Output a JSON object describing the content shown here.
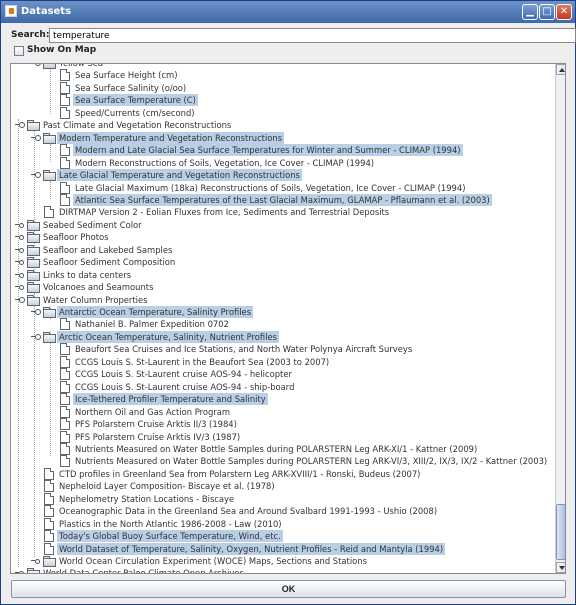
{
  "window": {
    "title": "Datasets",
    "icon": "java-app-icon",
    "controls": [
      "minimize",
      "maximize",
      "close"
    ]
  },
  "search": {
    "label": "Search:",
    "value": "temperature"
  },
  "show_on_map": {
    "label": "Show On Map",
    "checked": false
  },
  "tree": {
    "rows": [
      {
        "label": "Yellow Sea",
        "type": "folder",
        "level": 2,
        "handle": "expanded",
        "selected": false
      },
      {
        "label": "Sea Surface Height (cm)",
        "type": "file",
        "level": 3,
        "selected": false
      },
      {
        "label": "Sea Surface Salinity (o/oo)",
        "type": "file",
        "level": 3,
        "selected": false
      },
      {
        "label": "Sea Surface Temperature (C)",
        "type": "file",
        "level": 3,
        "selected": true
      },
      {
        "label": "Speed/Currents (cm/second)",
        "type": "file",
        "level": 3,
        "selected": false
      },
      {
        "label": "Past Climate and Vegetation Reconstructions",
        "type": "folder",
        "level": 1,
        "handle": "expanded",
        "selected": false
      },
      {
        "label": "Modern Temperature and Vegetation Reconstructions",
        "type": "folder",
        "level": 2,
        "handle": "expanded",
        "selected": true
      },
      {
        "label": "Modern and Late Glacial Sea Surface Temperatures for Winter and Summer - CLIMAP (1994)",
        "type": "file",
        "level": 3,
        "selected": true
      },
      {
        "label": "Modern Reconstructions of Soils, Vegetation, Ice Cover - CLIMAP (1994)",
        "type": "file",
        "level": 3,
        "selected": false
      },
      {
        "label": "Late Glacial Temperature and Vegetation Reconstructions",
        "type": "folder",
        "level": 2,
        "handle": "expanded",
        "selected": true
      },
      {
        "label": "Late Glacial Maximum (18ka) Reconstructions of Soils, Vegetation, Ice Cover - CLIMAP (1994)",
        "type": "file",
        "level": 3,
        "selected": false
      },
      {
        "label": "Atlantic Sea Surface Temperatures of the Last Glacial Maximum, GLAMAP - Pflaumann et al. (2003)",
        "type": "file",
        "level": 3,
        "selected": true
      },
      {
        "label": "DIRTMAP Version 2 - Eolian Fluxes from Ice, Sediments and Terrestrial Deposits",
        "type": "file",
        "level": 2,
        "selected": false
      },
      {
        "label": "Seabed Sediment Color",
        "type": "folder",
        "level": 1,
        "handle": "collapsed",
        "selected": false
      },
      {
        "label": "Seafloor Photos",
        "type": "folder",
        "level": 1,
        "handle": "collapsed",
        "selected": false
      },
      {
        "label": "Seafloor and Lakebed Samples",
        "type": "folder",
        "level": 1,
        "handle": "collapsed",
        "selected": false
      },
      {
        "label": "Seafloor Sediment Composition",
        "type": "folder",
        "level": 1,
        "handle": "collapsed",
        "selected": false
      },
      {
        "label": "Links to data centers",
        "type": "folder",
        "level": 1,
        "handle": "collapsed",
        "selected": false
      },
      {
        "label": "Volcanoes and Seamounts",
        "type": "folder",
        "level": 1,
        "handle": "collapsed",
        "selected": false
      },
      {
        "label": "Water Column Properties",
        "type": "folder",
        "level": 1,
        "handle": "expanded",
        "selected": false
      },
      {
        "label": "Antarctic Ocean Temperature, Salinity Profiles",
        "type": "folder",
        "level": 2,
        "handle": "expanded",
        "selected": true
      },
      {
        "label": "Nathaniel B. Palmer Expedition 0702",
        "type": "file",
        "level": 3,
        "selected": false
      },
      {
        "label": "Arctic Ocean Temperature, Salinity, Nutrient Profiles",
        "type": "folder",
        "level": 2,
        "handle": "expanded",
        "selected": true
      },
      {
        "label": "Beaufort Sea Cruises and Ice Stations, and North Water Polynya Aircraft Surveys",
        "type": "file",
        "level": 3,
        "selected": false
      },
      {
        "label": "CCGS Louis S. St-Laurent in the Beaufort Sea (2003 to 2007)",
        "type": "file",
        "level": 3,
        "selected": false
      },
      {
        "label": "CCGS Louis S. St-Laurent cruise AOS-94 - helicopter",
        "type": "file",
        "level": 3,
        "selected": false
      },
      {
        "label": "CCGS Louis S. St-Laurent cruise AOS-94 - ship-board",
        "type": "file",
        "level": 3,
        "selected": false
      },
      {
        "label": "Ice-Tethered Profiler Temperature and Salinity",
        "type": "file",
        "level": 3,
        "selected": true
      },
      {
        "label": "Northern Oil and Gas Action Program",
        "type": "file",
        "level": 3,
        "selected": false
      },
      {
        "label": "PFS Polarstern Cruise Arktis II/3 (1984)",
        "type": "file",
        "level": 3,
        "selected": false
      },
      {
        "label": "PFS Polarstern Cruise Arktis IV/3 (1987)",
        "type": "file",
        "level": 3,
        "selected": false
      },
      {
        "label": "Nutrients Measured on Water Bottle Samples during POLARSTERN Leg ARK-XI/1 - Kattner (2009)",
        "type": "file",
        "level": 3,
        "selected": false
      },
      {
        "label": "Nutrients Measured on Water Bottle Samples during POLARSTERN Leg ARK-VI/3, XIII/2, IX/3, IX/2 - Kattner (2003)",
        "type": "file",
        "level": 3,
        "selected": false
      },
      {
        "label": "CTD profiles in Greenland Sea from Polarstern Leg ARK-XVIII/1 - Ronski, Budeus  (2007)",
        "type": "file",
        "level": 2,
        "selected": false
      },
      {
        "label": "Nepheloid Layer Composition- Biscaye et al. (1978)",
        "type": "file",
        "level": 2,
        "selected": false
      },
      {
        "label": "Nephelometry Station Locations - Biscaye",
        "type": "file",
        "level": 2,
        "selected": false
      },
      {
        "label": "Oceanographic Data in the Greenland Sea and Around Svalbard 1991-1993 - Ushio (2008)",
        "type": "file",
        "level": 2,
        "selected": false
      },
      {
        "label": "Plastics in the North Atlantic 1986-2008 - Law (2010)",
        "type": "file",
        "level": 2,
        "selected": false
      },
      {
        "label": "Today's Global Buoy Surface Temperature, Wind, etc.",
        "type": "file",
        "level": 2,
        "selected": true
      },
      {
        "label": "World Dataset of Temperature, Salinity, Oxygen, Nutrient Profiles - Reid and Mantyla (1994)",
        "type": "file",
        "level": 2,
        "selected": true
      },
      {
        "label": "World Ocean Circulation Experiment (WOCE) Maps, Sections and Stations",
        "type": "folder",
        "level": 2,
        "handle": "collapsed",
        "selected": false
      },
      {
        "label": "World Data Center Paleo Climate Open Archives",
        "type": "folder",
        "level": 1,
        "handle": "collapsed",
        "selected": false
      }
    ]
  },
  "ok_button": {
    "label": "OK"
  },
  "colors": {
    "selection": "#b8cfe5",
    "titlebar": "#3d6aa8"
  }
}
